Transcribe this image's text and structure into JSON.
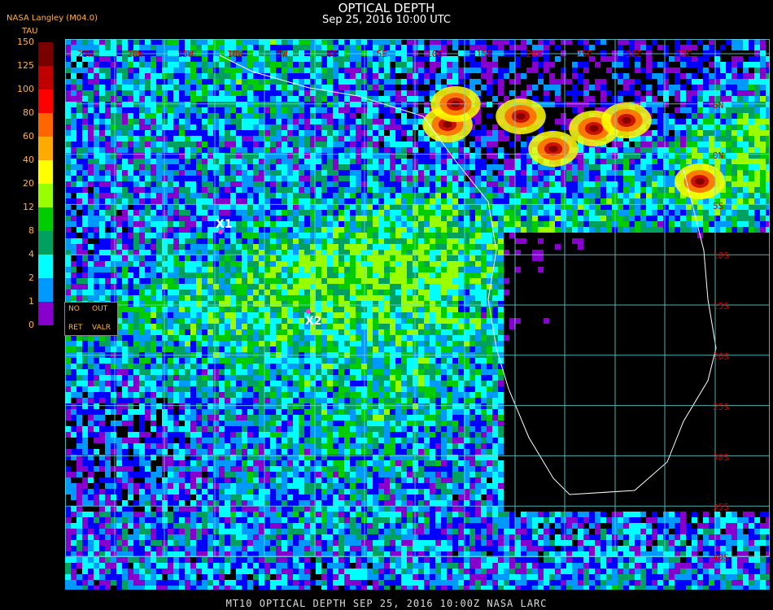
{
  "header": {
    "title": "OPTICAL DEPTH",
    "subtitle": "Sep 25, 2016 10:00 UTC",
    "source": "NASA Langley (M04.0)"
  },
  "legend": {
    "unit": "TAU",
    "ticks": [
      "150",
      "125",
      "100",
      "80",
      "60",
      "40",
      "20",
      "12",
      "8",
      "4",
      "2",
      "1",
      "0"
    ],
    "colors": [
      "#7a0000",
      "#c00000",
      "#ff0000",
      "#ff6600",
      "#ffaa00",
      "#ffff00",
      "#99ff00",
      "#00cc00",
      "#00a060",
      "#00ffff",
      "#0099ff",
      "#0000ff",
      "#8800cc"
    ]
  },
  "key_box": {
    "no": "NO",
    "out": "OUT",
    "ret": "RET",
    "valr": "VALR"
  },
  "grid": {
    "lon_labels": [
      "25W",
      "20W",
      "15W",
      "10W",
      "5W",
      "0E",
      "5E",
      "10E",
      "15E",
      "20E",
      "25E",
      "30E",
      "35E"
    ],
    "lat_labels": [
      "5N",
      "0N",
      "5S",
      "10S",
      "15S",
      "20S",
      "25S",
      "30S",
      "35S",
      "40S"
    ]
  },
  "markers": [
    {
      "label": "X1"
    },
    {
      "label": "X2"
    }
  ],
  "footer": "MT10  OPTICAL DEPTH   SEP 25, 2016 10:00Z   NASA LARC"
}
